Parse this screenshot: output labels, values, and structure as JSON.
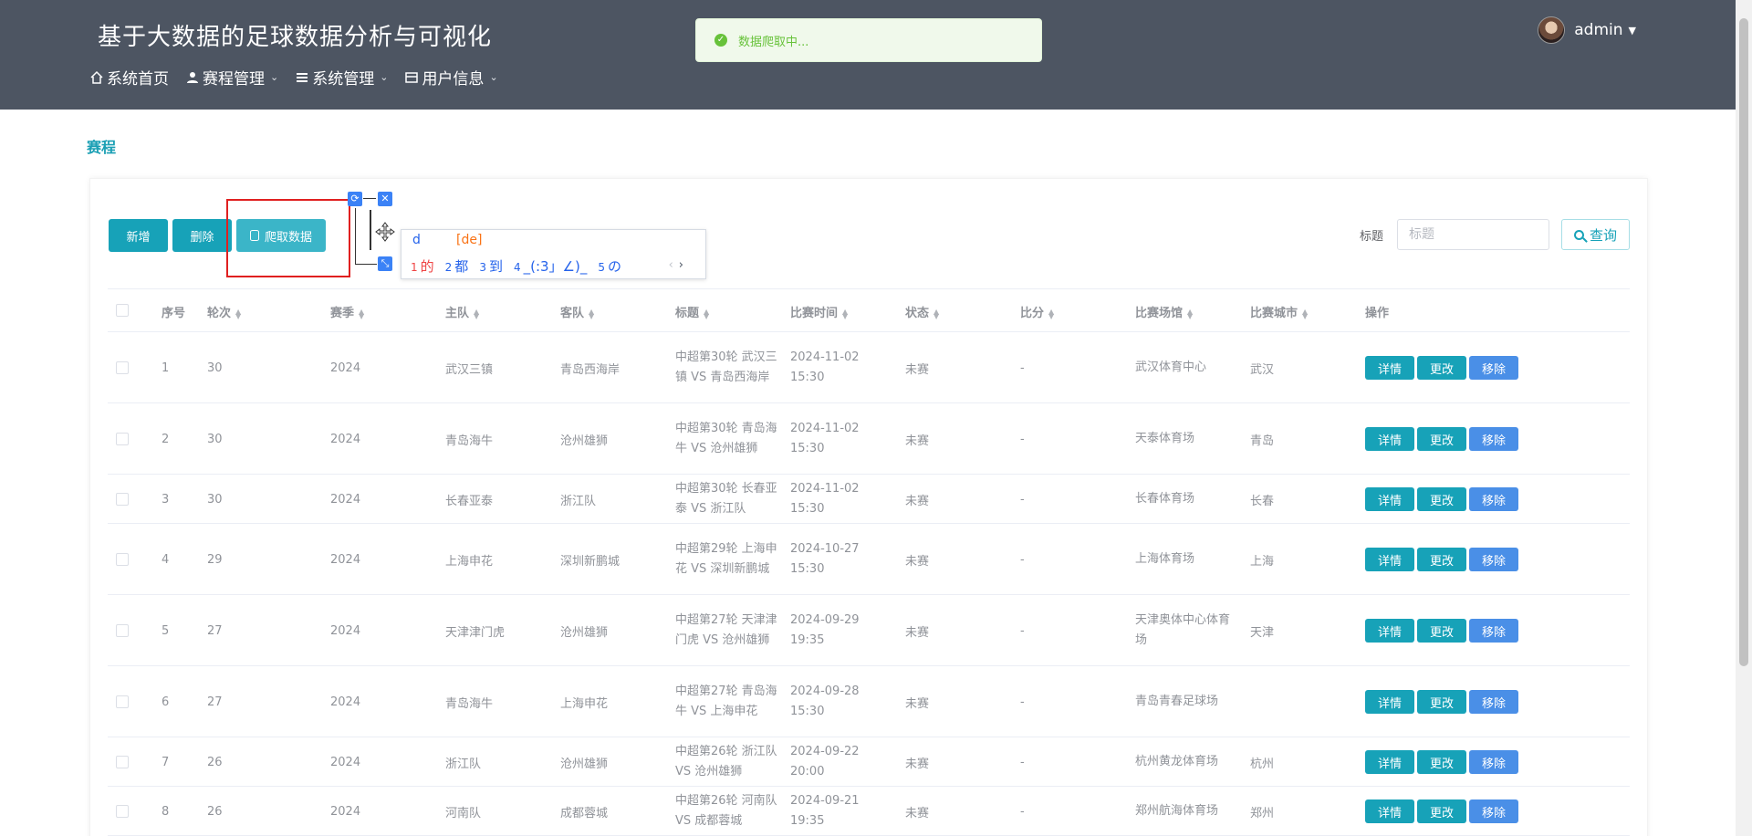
{
  "header": {
    "title": "基于大数据的足球数据分析与可视化",
    "nav": [
      {
        "label": "系统首页",
        "icon": "home-icon",
        "dropdown": false
      },
      {
        "label": "赛程管理",
        "icon": "user-icon",
        "dropdown": true
      },
      {
        "label": "系统管理",
        "icon": "list-icon",
        "dropdown": true
      },
      {
        "label": "用户信息",
        "icon": "card-icon",
        "dropdown": true
      }
    ],
    "user": "admin"
  },
  "toast": {
    "message": "数据爬取中..."
  },
  "page": {
    "crumb": "赛程"
  },
  "toolbar": {
    "add_label": "新增",
    "delete_label": "删除",
    "crawl_label": "爬取数据"
  },
  "ime": {
    "typed": "d",
    "pinyin": "[de]",
    "candidates": [
      {
        "n": "1",
        "text": "的"
      },
      {
        "n": "2",
        "text": "都"
      },
      {
        "n": "3",
        "text": "到"
      },
      {
        "n": "4",
        "text": "_(:3」∠)_"
      },
      {
        "n": "5",
        "text": "の"
      }
    ]
  },
  "search": {
    "label": "标题",
    "placeholder": "标题",
    "button": "查询"
  },
  "table": {
    "headers": [
      "序号",
      "轮次",
      "赛季",
      "主队",
      "客队",
      "标题",
      "比赛时间",
      "状态",
      "比分",
      "比赛场馆",
      "比赛城市",
      "操作"
    ],
    "op_labels": {
      "detail": "详情",
      "edit": "更改",
      "remove": "移除"
    },
    "rows": [
      {
        "no": "1",
        "round": "30",
        "season": "2024",
        "home": "武汉三镇",
        "away": "青岛西海岸",
        "title": "中超第30轮 武汉三镇 VS 青岛西海岸",
        "time": "2024-11-02 15:30",
        "status": "未赛",
        "score": "-",
        "venue": "武汉体育中心",
        "city": "武汉"
      },
      {
        "no": "2",
        "round": "30",
        "season": "2024",
        "home": "青岛海牛",
        "away": "沧州雄狮",
        "title": "中超第30轮 青岛海牛 VS 沧州雄狮",
        "time": "2024-11-02 15:30",
        "status": "未赛",
        "score": "-",
        "venue": "天泰体育场",
        "city": "青岛"
      },
      {
        "no": "3",
        "round": "30",
        "season": "2024",
        "home": "长春亚泰",
        "away": "浙江队",
        "title": "中超第30轮 长春亚泰 VS 浙江队",
        "time": "2024-11-02 15:30",
        "status": "未赛",
        "score": "-",
        "venue": "长春体育场",
        "city": "长春"
      },
      {
        "no": "4",
        "round": "29",
        "season": "2024",
        "home": "上海申花",
        "away": "深圳新鹏城",
        "title": "中超第29轮 上海申花 VS 深圳新鹏城",
        "time": "2024-10-27 15:30",
        "status": "未赛",
        "score": "-",
        "venue": "上海体育场",
        "city": "上海"
      },
      {
        "no": "5",
        "round": "27",
        "season": "2024",
        "home": "天津津门虎",
        "away": "沧州雄狮",
        "title": "中超第27轮 天津津门虎 VS 沧州雄狮",
        "time": "2024-09-29 19:35",
        "status": "未赛",
        "score": "-",
        "venue": "天津奥体中心体育场",
        "city": "天津"
      },
      {
        "no": "6",
        "round": "27",
        "season": "2024",
        "home": "青岛海牛",
        "away": "上海申花",
        "title": "中超第27轮 青岛海牛 VS 上海申花",
        "time": "2024-09-28 15:30",
        "status": "未赛",
        "score": "-",
        "venue": "青岛青春足球场",
        "city": ""
      },
      {
        "no": "7",
        "round": "26",
        "season": "2024",
        "home": "浙江队",
        "away": "沧州雄狮",
        "title": "中超第26轮 浙江队 VS 沧州雄狮",
        "time": "2024-09-22 20:00",
        "status": "未赛",
        "score": "-",
        "venue": "杭州黄龙体育场",
        "city": "杭州"
      },
      {
        "no": "8",
        "round": "26",
        "season": "2024",
        "home": "河南队",
        "away": "成都蓉城",
        "title": "中超第26轮 河南队 VS 成都蓉城",
        "time": "2024-09-21 19:35",
        "status": "未赛",
        "score": "-",
        "venue": "郑州航海体育场",
        "city": "郑州"
      }
    ]
  }
}
